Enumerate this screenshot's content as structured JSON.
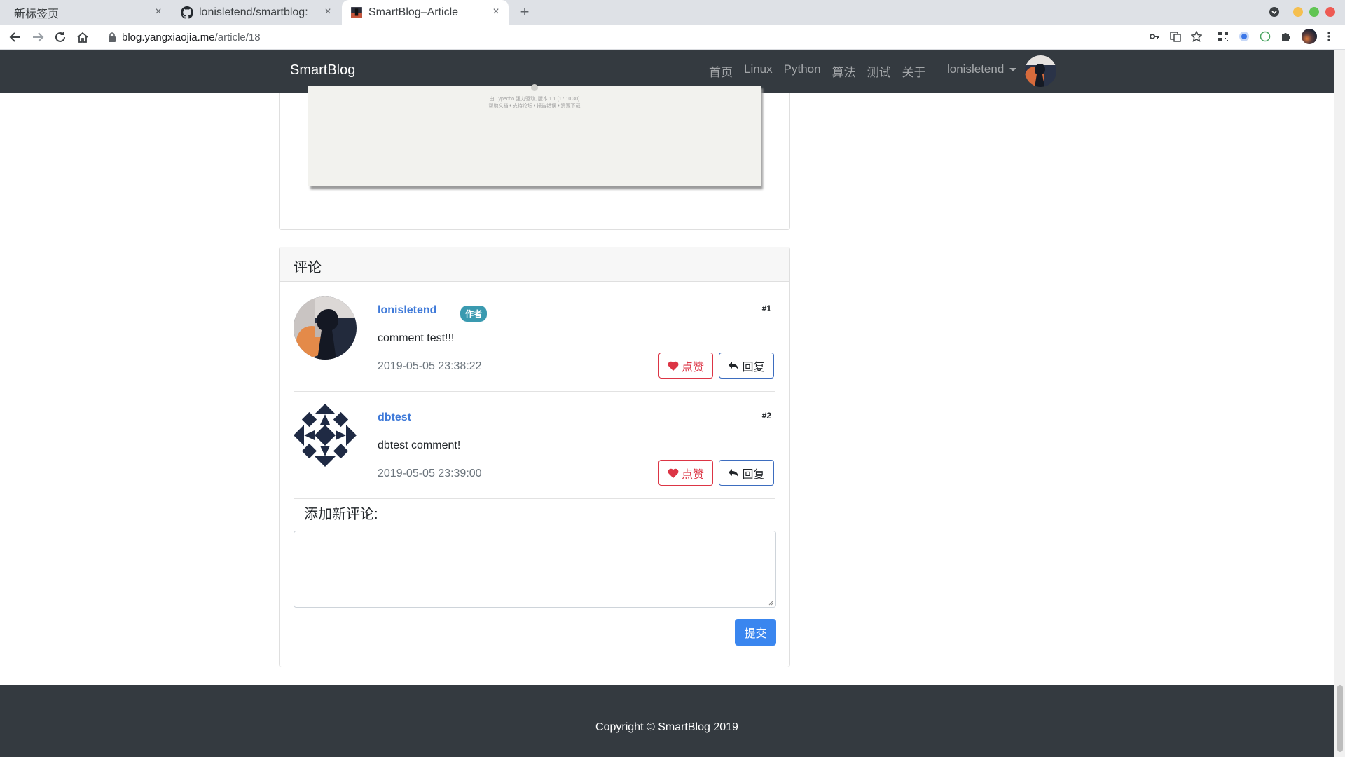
{
  "browser": {
    "tabs": [
      {
        "title": "新标签页",
        "active": false
      },
      {
        "title": "lonisletend/smartblog:",
        "active": false
      },
      {
        "title": "SmartBlog–Article",
        "active": true
      }
    ],
    "close_glyph": "×",
    "new_tab_glyph": "+",
    "url_host": "blog.yangxiaojia.me",
    "url_path": "/article/18",
    "window_colors": {
      "minimize": "#f5bf4f",
      "maximize": "#61c554",
      "close": "#ee5b54"
    }
  },
  "site": {
    "brand": "SmartBlog",
    "nav": [
      "首页",
      "Linux",
      "Python",
      "算法",
      "测试",
      "关于"
    ],
    "user": "lonisletend",
    "article_image": {
      "caption_line1": "由 Typecho 强力驱动, 版本 1.1 (17.10.30)",
      "caption_line2": "帮助文档 • 支持论坛 • 报告错误 • 资源下载"
    },
    "comments_header": "评论",
    "comments": [
      {
        "author": "lonisletend",
        "badge": "作者",
        "floor": "#1",
        "text": "comment test!!!",
        "time": "2019-05-05 23:38:22",
        "like_label": "点赞",
        "reply_label": "回复"
      },
      {
        "author": "dbtest",
        "badge": "",
        "floor": "#2",
        "text": "dbtest comment!",
        "time": "2019-05-05 23:39:00",
        "like_label": "点赞",
        "reply_label": "回复"
      }
    ],
    "add_comment_title": "添加新评论:",
    "submit_label": "提交",
    "footer": "Copyright © SmartBlog 2019",
    "colors": {
      "navbar": "#343a40",
      "link": "#3f7ad9",
      "like": "#dc3545",
      "submit": "#3a86ef",
      "badge": "#3a9ab0"
    }
  }
}
